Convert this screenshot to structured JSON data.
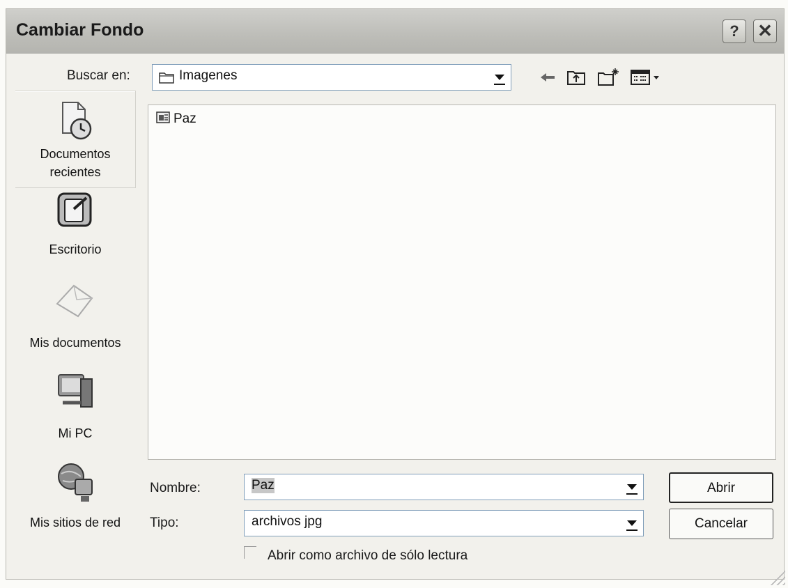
{
  "window": {
    "title": "Cambiar Fondo",
    "help_label": "?",
    "close_label": "✕"
  },
  "lookin": {
    "label": "Buscar en:",
    "value": "Imagenes"
  },
  "toolbar": {
    "icons": [
      "back-arrow-icon",
      "up-folder-icon",
      "new-folder-icon",
      "view-menu-icon"
    ]
  },
  "places": [
    {
      "label_line1": "Documentos",
      "label_line2": "recientes",
      "icon": "recent-documents-icon"
    },
    {
      "label_line1": "Escritorio",
      "label_line2": "",
      "icon": "desktop-icon"
    },
    {
      "label_line1": "Mis documentos",
      "label_line2": "",
      "icon": "my-documents-icon"
    },
    {
      "label_line1": "Mi PC",
      "label_line2": "",
      "icon": "my-computer-icon"
    },
    {
      "label_line1": "Mis sitios de red",
      "label_line2": "",
      "icon": "network-places-icon"
    }
  ],
  "files": [
    {
      "name": "Paz",
      "icon": "image-folder-icon"
    }
  ],
  "filename": {
    "label": "Nombre:",
    "value": "Paz"
  },
  "filetype": {
    "label": "Tipo:",
    "value": "archivos jpg"
  },
  "readonly": {
    "label": "Abrir como archivo de sólo lectura",
    "checked": false
  },
  "buttons": {
    "open": "Abrir",
    "cancel": "Cancelar"
  }
}
